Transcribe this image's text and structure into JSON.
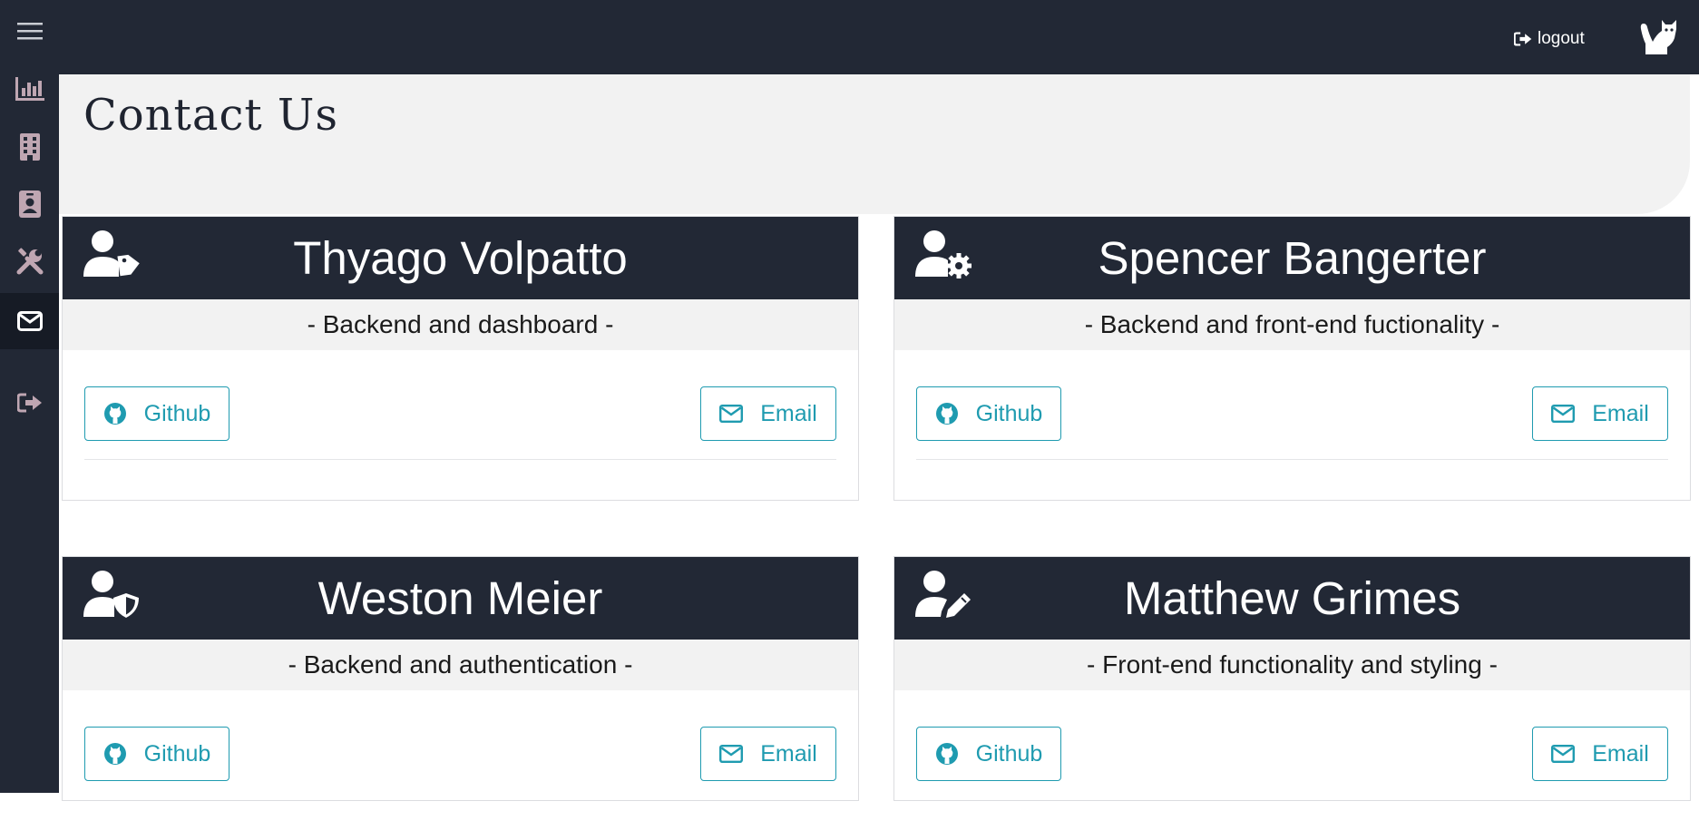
{
  "header": {
    "logout_label": "logout"
  },
  "page": {
    "title": "Contact Us"
  },
  "sidebar": {
    "items": [
      {
        "icon": "hamburger-menu-icon"
      },
      {
        "icon": "bar-chart-icon"
      },
      {
        "icon": "building-icon"
      },
      {
        "icon": "id-badge-icon"
      },
      {
        "icon": "tools-icon"
      },
      {
        "icon": "envelope-icon",
        "active": true
      },
      {
        "icon": "sign-out-icon"
      }
    ]
  },
  "contacts": [
    {
      "name": "Thyago Volpatto",
      "role": "- Backend and dashboard -",
      "icon": "user-tag-icon",
      "github_label": "Github",
      "email_label": "Email"
    },
    {
      "name": "Spencer Bangerter",
      "role": "- Backend and front-end fuctionality -",
      "icon": "user-cog-icon",
      "github_label": "Github",
      "email_label": "Email"
    },
    {
      "name": "Weston Meier",
      "role": "- Backend and authentication -",
      "icon": "user-shield-icon",
      "github_label": "Github",
      "email_label": "Email"
    },
    {
      "name": "Matthew Grimes",
      "role": "- Front-end functionality and styling -",
      "icon": "user-edit-icon",
      "github_label": "Github",
      "email_label": "Email"
    }
  ],
  "colors": {
    "navy": "#222835",
    "accent": "#1f9bb0",
    "panel": "#f2f2f2"
  }
}
